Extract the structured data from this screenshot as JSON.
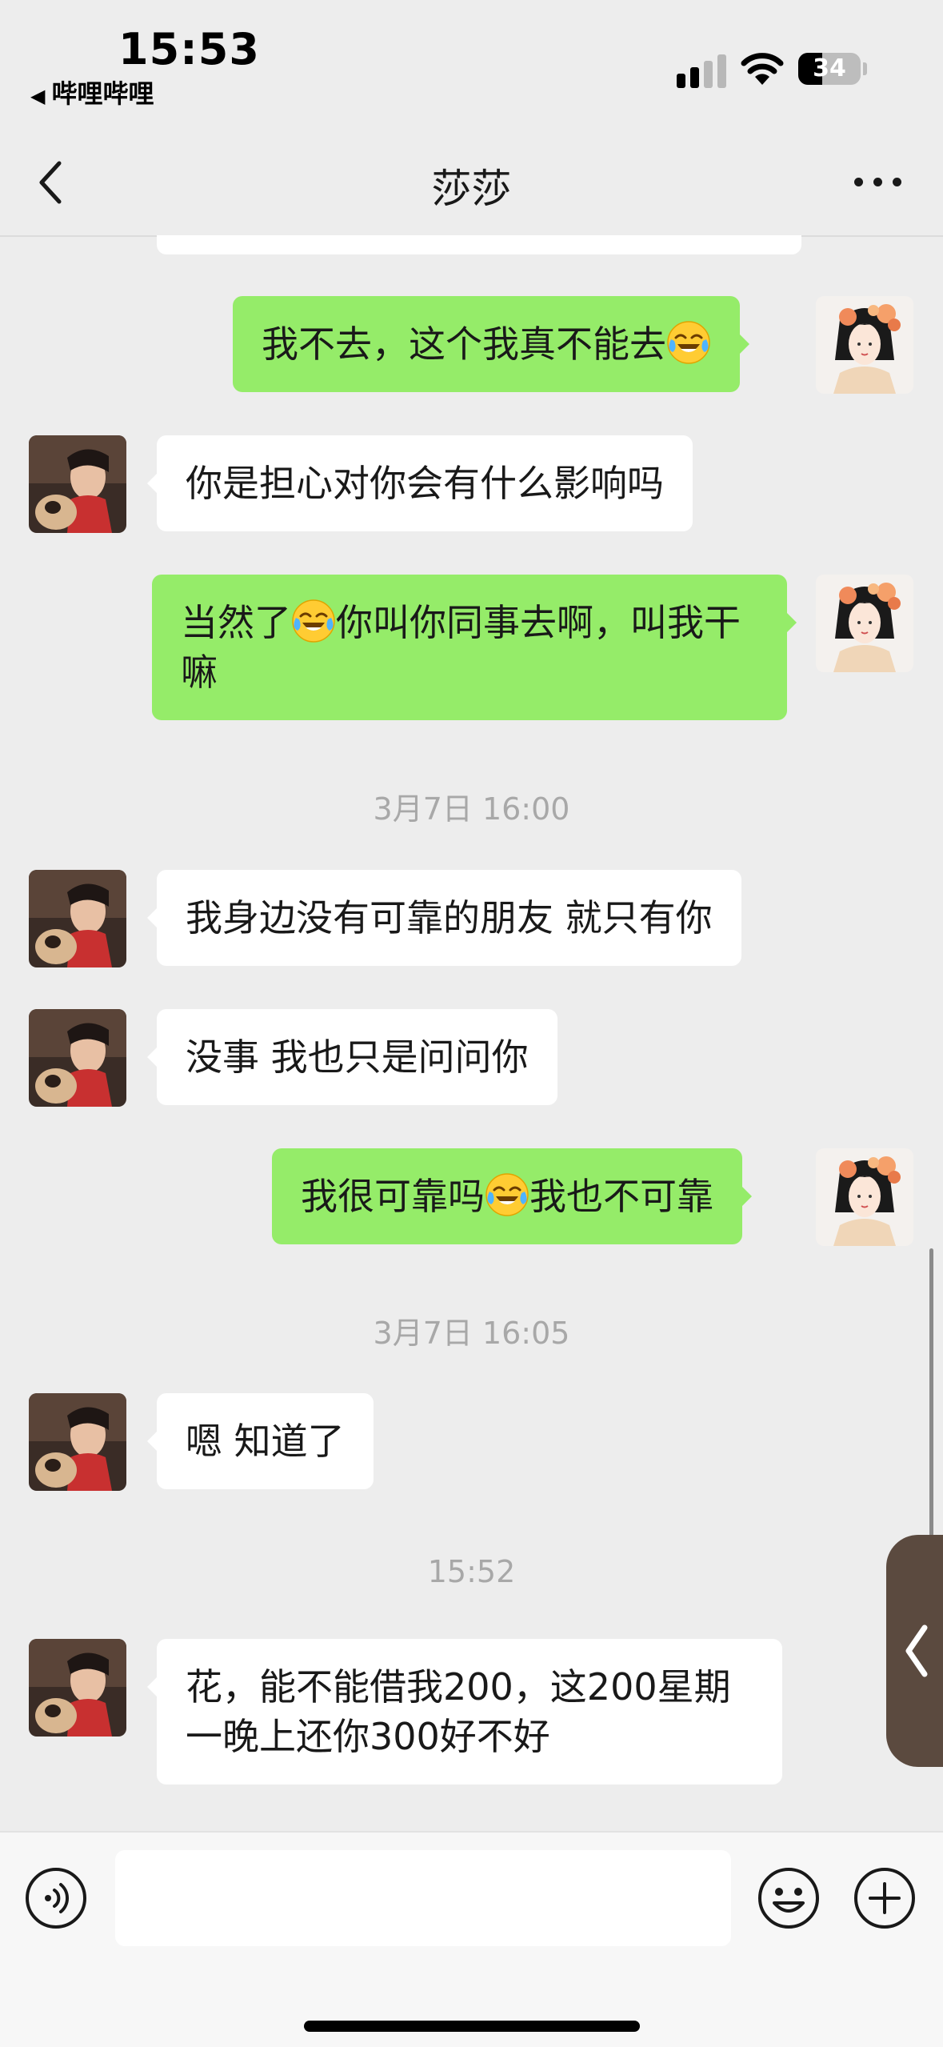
{
  "status_bar": {
    "time": "15:53",
    "back_app": "哔哩哔哩",
    "battery": "34"
  },
  "nav": {
    "title": "莎莎"
  },
  "messages": [
    {
      "side": "out",
      "text_before": "我不去，这个我真不能去",
      "emoji": "laugh-cry",
      "text_after": ""
    },
    {
      "side": "in",
      "text": "你是担心对你会有什么影响吗"
    },
    {
      "side": "out",
      "text_before": "当然了",
      "emoji": "laugh-cry",
      "text_after": "你叫你同事去啊，叫我干嘛"
    },
    {
      "side": "time",
      "text": "3月7日 16:00"
    },
    {
      "side": "in",
      "text": "我身边没有可靠的朋友 就只有你"
    },
    {
      "side": "in",
      "text": "没事 我也只是问问你"
    },
    {
      "side": "out",
      "text_before": "我很可靠吗",
      "emoji": "laugh-cry",
      "text_after": "我也不可靠"
    },
    {
      "side": "time",
      "text": "3月7日 16:05"
    },
    {
      "side": "in",
      "text": "嗯 知道了"
    },
    {
      "side": "time",
      "text": "15:52"
    },
    {
      "side": "in",
      "text": "花，能不能借我200，这200星期一晚上还你300好不好"
    }
  ],
  "colors": {
    "outgoing_bubble": "#95ec69",
    "incoming_bubble": "#ffffff",
    "background": "#ededed",
    "timestamp": "#a8a8a8"
  },
  "icons": {
    "back": "chevron-left-icon",
    "more": "more-dots-icon",
    "voice": "voice-icon",
    "emoji": "emoji-icon",
    "plus": "plus-icon",
    "side_tab": "chevron-left-icon"
  }
}
